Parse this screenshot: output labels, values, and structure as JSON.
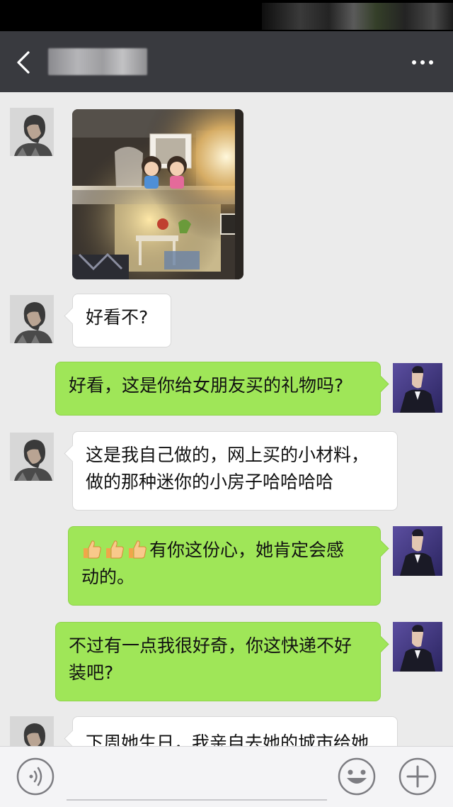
{
  "header": {
    "title": "",
    "back_icon": "chevron-left-icon",
    "more_icon": "more-dots-icon"
  },
  "colors": {
    "nav_bg": "#393a3f",
    "chat_bg": "#ebebeb",
    "bubble_sent": "#9fe658",
    "bubble_received": "#ffffff"
  },
  "messages": [
    {
      "sender": "other",
      "type": "image",
      "image_desc": "miniature dollhouse with two figurines"
    },
    {
      "sender": "other",
      "type": "text",
      "text": "好看不?"
    },
    {
      "sender": "self",
      "type": "text",
      "text": "好看，这是你给女朋友买的礼物吗?"
    },
    {
      "sender": "other",
      "type": "text",
      "lines": [
        "这是我自己做的，网上买的小材料，",
        "做的那种迷你的小房子哈哈哈哈"
      ]
    },
    {
      "sender": "self",
      "type": "text",
      "emoji": [
        "thumbs-up-icon",
        "thumbs-up-icon",
        "thumbs-up-icon"
      ],
      "lines": [
        "有你这份心，她肯定会感",
        "动的。"
      ]
    },
    {
      "sender": "self",
      "type": "text",
      "lines": [
        "不过有一点我很好奇，你这快递不好",
        "装吧?"
      ]
    },
    {
      "sender": "other",
      "type": "text",
      "text": "下周她生日，我亲自去她的城市给她"
    }
  ],
  "input_bar": {
    "voice_icon": "voice-icon",
    "input_value": "",
    "emoji_icon": "emoji-icon",
    "plus_icon": "plus-icon"
  }
}
